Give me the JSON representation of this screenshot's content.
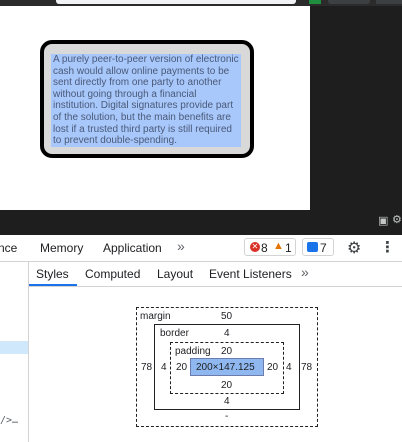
{
  "page": {
    "demo_text": "A purely peer-to-peer version of electronic cash would allow online payments to be sent directly from one party to another without going through a financial institution. Digital signatures provide part of the solution, but the main benefits are lost if a trusted third party is still required to prevent double-spending."
  },
  "devtools": {
    "tabs": [
      "nce",
      "Memory",
      "Application"
    ],
    "more_tabs": "»",
    "issues": {
      "errors": "8",
      "warnings": "1",
      "messages": "7"
    },
    "icons": {
      "error": "error-icon",
      "warning": "warning-icon",
      "message": "message-icon",
      "settings": "gear-icon",
      "menu": "kebab-icon",
      "bookmark": "bookmark-icon"
    },
    "left_pane_snippet": "/>…",
    "sub_tabs": [
      "Styles",
      "Computed",
      "Layout",
      "Event Listeners"
    ],
    "sub_tabs_more": "»",
    "active_sub_tab": "Styles"
  },
  "box_model": {
    "margin": {
      "label": "margin",
      "top": "50",
      "right": "78",
      "bottom": "-",
      "left": "78"
    },
    "border": {
      "label": "border",
      "top": "4",
      "right": "4",
      "bottom": "4",
      "left": "4"
    },
    "padding": {
      "label": "padding",
      "top": "20",
      "right": "20",
      "bottom": "20",
      "left": "20"
    },
    "content": "200×147.125"
  },
  "colors": {
    "selection": "#a8c7fa",
    "content_box": "#8fb8f0",
    "accent": "#1a73e8",
    "error": "#d93025",
    "warning": "#e37400"
  }
}
